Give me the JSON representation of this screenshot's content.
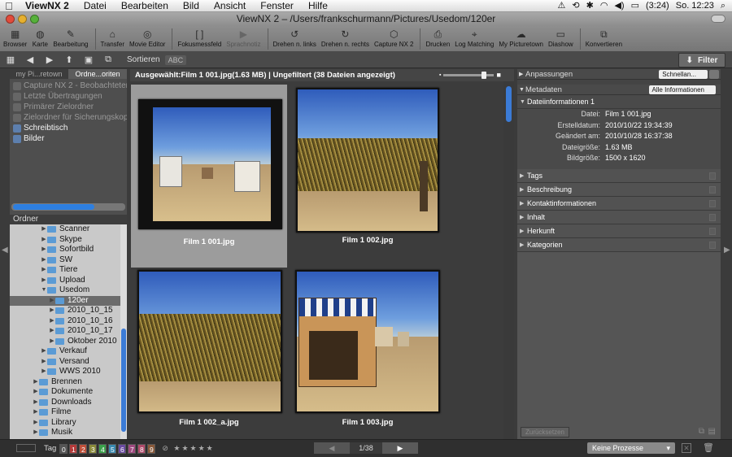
{
  "menubar": {
    "app": "ViewNX 2",
    "menus": [
      "Datei",
      "Bearbeiten",
      "Bild",
      "Ansicht",
      "Fenster",
      "Hilfe"
    ],
    "battery": "(3:24)",
    "clock": "So. 12:23"
  },
  "window": {
    "title": "ViewNX 2 – /Users/frankschurmann/Pictures/Usedom/120er"
  },
  "toolbar": {
    "buttons": [
      "Browser",
      "Karte",
      "Bearbeitung",
      "Transfer",
      "Movie Editor",
      "Fokusmessfeld",
      "Sprachnotiz",
      "Drehen n. links",
      "Drehen n. rechts",
      "Capture NX 2",
      "Drucken",
      "Log Matching",
      "My Picturetown",
      "Diashow",
      "Konvertieren"
    ]
  },
  "bar2": {
    "sort_label": "Sortieren",
    "sort_value": "ABC",
    "filter": "Filter"
  },
  "left": {
    "tabs": [
      "my Pi...retown",
      "Ordne...oriten"
    ],
    "links": [
      "Capture NX 2 - Beobachteter O",
      "Letzte Übertragungen",
      "Primärer Zielordner",
      "Zielordner für Sicherungskopie"
    ],
    "places": [
      "Schreibtisch",
      "Bilder"
    ],
    "tree_header": "Ordner",
    "tree": [
      "Scanner",
      "Skype",
      "Sofortbild",
      "SW",
      "Tiere",
      "Upload",
      "Usedom",
      "120er",
      "2010_10_15",
      "2010_10_16",
      "2010_10_17",
      "Oktober 2010",
      "Verkauf",
      "Versand",
      "WWS 2010",
      "Brennen",
      "Dokumente",
      "Downloads",
      "Filme",
      "Library",
      "Musik"
    ]
  },
  "center": {
    "header": "Ausgewählt:Film 1 001.jpg(1.63 MB) | Ungefiltert (38 Dateien angezeigt)",
    "items": [
      "Film 1 001.jpg",
      "Film 1 002.jpg",
      "Film 1 002_a.jpg",
      "Film 1 003.jpg"
    ]
  },
  "right": {
    "anpassungen": "Anpassungen",
    "anpassungen_dd": "Schnellan...",
    "metadaten": "Metadaten",
    "metadaten_dd": "Alle Informationen",
    "dateiinfo": "Dateiinformationen 1",
    "meta": [
      {
        "k": "Datei:",
        "v": "Film 1 001.jpg"
      },
      {
        "k": "Erstelldatum:",
        "v": "2010/10/22 19:34:39"
      },
      {
        "k": "Geändert am:",
        "v": "2010/10/28 16:37:38"
      },
      {
        "k": "Dateigröße:",
        "v": "1.63 MB"
      },
      {
        "k": "Bildgröße:",
        "v": "1500 x 1620"
      }
    ],
    "sections": [
      "Tags",
      "Beschreibung",
      "Kontaktinformationen",
      "Inhalt",
      "Herkunft",
      "Kategorien"
    ],
    "reset": "Zurücksetzen"
  },
  "status": {
    "tag_label": "Tag",
    "tags": [
      "0",
      "1",
      "2",
      "3",
      "4",
      "5",
      "6",
      "7",
      "8",
      "9"
    ],
    "tag_colors": [
      "#555555",
      "#b33a3a",
      "#c0503a",
      "#8a8a3a",
      "#3aa04a",
      "#3a8ab0",
      "#6a4aa0",
      "#a04a80",
      "#b04a6a",
      "#8a5a3a"
    ],
    "page": "1/38",
    "process": "Keine Prozesse"
  }
}
